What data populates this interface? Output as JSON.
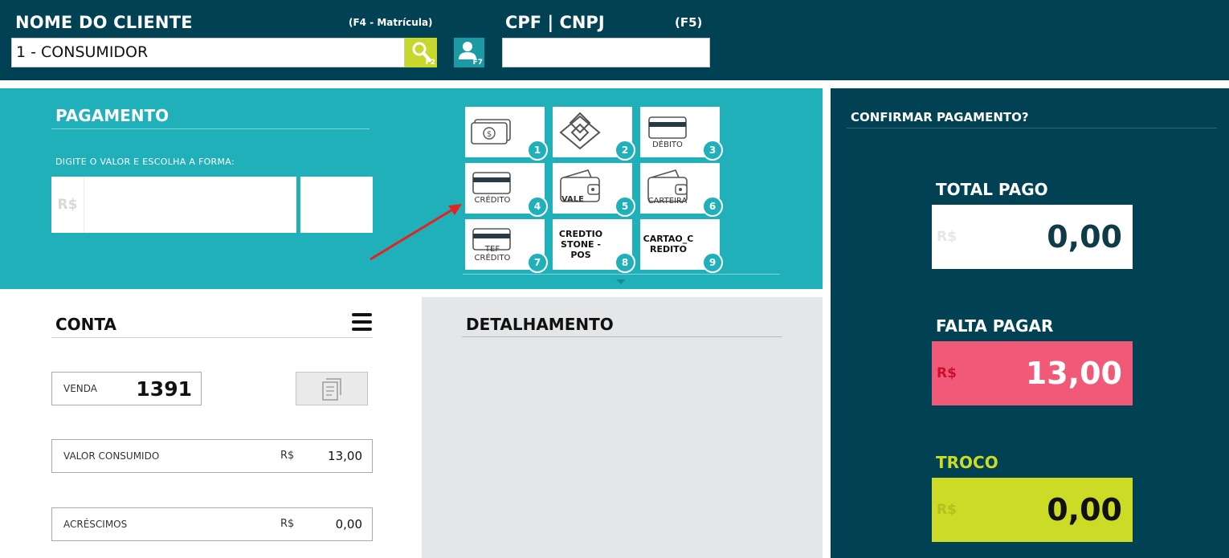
{
  "header": {
    "client_label": "NOME DO CLIENTE",
    "client_hint": "(F4 - Matrícula)",
    "client_value": "1 - CONSUMIDOR",
    "search_key": "F2",
    "user_key": "F7",
    "cpf_label": "CPF | CNPJ",
    "cpf_key": "(F5)",
    "cpf_value": ""
  },
  "payment": {
    "title": "PAGAMENTO",
    "instruction": "DIGITE O VALOR E ESCOLHA A FORMA:",
    "currency": "R$",
    "amount_value": "",
    "methods": [
      {
        "num": "1",
        "icon": "cash-icon",
        "caption": ""
      },
      {
        "num": "2",
        "icon": "pix-icon",
        "caption": ""
      },
      {
        "num": "3",
        "icon": "debit-card-icon",
        "caption": "DÉBITO"
      },
      {
        "num": "4",
        "icon": "credit-card-icon",
        "caption": "CRÉDITO"
      },
      {
        "num": "5",
        "icon": "wallet-icon",
        "caption": "VALE"
      },
      {
        "num": "6",
        "icon": "wallet-icon",
        "caption": "CARTEIRA"
      },
      {
        "num": "7",
        "icon": "tef-credit-card-icon",
        "caption": "TEF\nCRÉDITO"
      },
      {
        "num": "8",
        "icon": "",
        "caption": "CREDTIO\nSTONE -\nPOS"
      },
      {
        "num": "9",
        "icon": "",
        "caption": "CARTAO_C\nREDITO"
      }
    ]
  },
  "conta": {
    "title": "CONTA",
    "venda_label": "VENDA",
    "venda_value": "1391",
    "consumido_label": "VALOR CONSUMIDO",
    "consumido_currency": "R$",
    "consumido_value": "13,00",
    "acrescimos_label": "ACRÉSCIMOS",
    "acrescimos_currency": "R$",
    "acrescimos_value": "0,00"
  },
  "detalhamento": {
    "title": "DETALHAMENTO"
  },
  "confirm": {
    "title": "CONFIRMAR PAGAMENTO?",
    "total_pago_label": "TOTAL PAGO",
    "total_pago_currency": "R$",
    "total_pago_value": "0,00",
    "falta_pagar_label": "FALTA PAGAR",
    "falta_pagar_currency": "R$",
    "falta_pagar_value": "13,00",
    "troco_label": "TROCO",
    "troco_currency": "R$",
    "troco_value": "0,00"
  },
  "colors": {
    "header_bg": "#004154",
    "payment_bg": "#1fb0b9",
    "falta_bg": "#f05a78",
    "troco_bg": "#ccdb26",
    "search_btn": "#c8d72c",
    "annotation_arrow": "#e52222"
  }
}
